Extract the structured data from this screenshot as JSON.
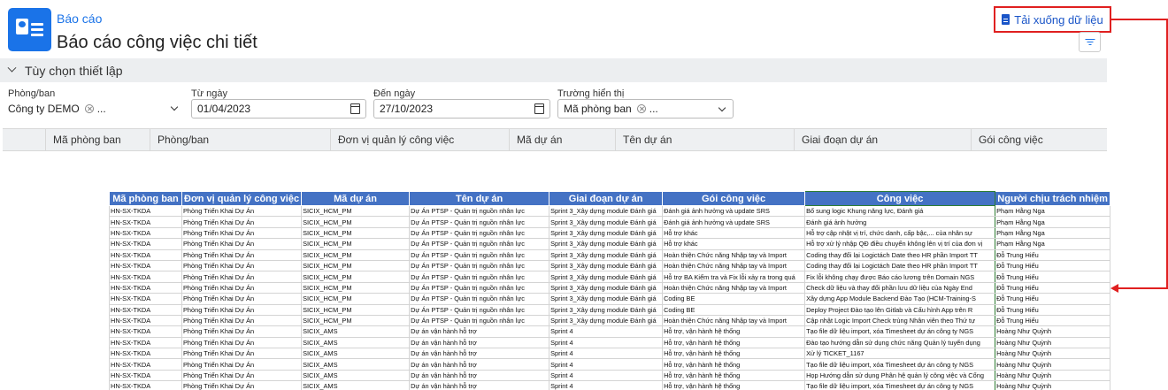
{
  "header": {
    "breadcrumb": "Báo cáo",
    "title": "Báo cáo công việc chi tiết",
    "download_label": "Tải xuống dữ liệu"
  },
  "options": {
    "label": "Tùy chọn thiết lập"
  },
  "filters": {
    "department": {
      "label": "Phòng/ban",
      "value": "Công ty DEMO",
      "more": "..."
    },
    "from_date": {
      "label": "Từ ngày",
      "value": "01/04/2023"
    },
    "to_date": {
      "label": "Đến ngày",
      "value": "27/10/2023"
    },
    "display_field": {
      "label": "Trường hiển thị",
      "value": "Mã phòng ban",
      "more": "..."
    }
  },
  "grid_columns": [
    "Mã phòng ban",
    "Phòng/ban",
    "Đơn vị quản lý công việc",
    "Mã dự án",
    "Tên dự án",
    "Giai đoạn dự án",
    "Gói công việc"
  ],
  "sheet": {
    "headers": [
      "Mã phòng ban",
      "Đơn vị quản lý công việc",
      "Mã dự án",
      "Tên dự án",
      "Giai đoạn dự án",
      "Gói công việc",
      "Công việc",
      "Người chịu trách nhiệm"
    ],
    "rows": [
      [
        "HN-SX-TKDA",
        "Phòng Triển Khai Dự Án",
        "SICIX_HCM_PM",
        "Dự Án PTSP - Quản trị nguồn nhân lực",
        "Sprint 3_Xây dựng module Đánh giá",
        "Đánh giá ảnh hưởng và update SRS",
        "Bổ sung logic Khung năng lực, Đánh giá",
        "Phạm Hằng Nga"
      ],
      [
        "HN-SX-TKDA",
        "Phòng Triển Khai Dự Án",
        "SICIX_HCM_PM",
        "Dự Án PTSP - Quản trị nguồn nhân lực",
        "Sprint 3_Xây dựng module Đánh giá",
        "Đánh giá ảnh hưởng và update SRS",
        "Đánh giá ảnh hưởng",
        "Phạm Hằng Nga"
      ],
      [
        "HN-SX-TKDA",
        "Phòng Triển Khai Dự Án",
        "SICIX_HCM_PM",
        "Dự Án PTSP - Quản trị nguồn nhân lực",
        "Sprint 3_Xây dựng module Đánh giá",
        "Hỗ trợ khác",
        "Hỗ trợ cập nhật vị trí, chức danh, cấp bậc,... của nhân sự",
        "Phạm Hằng Nga"
      ],
      [
        "HN-SX-TKDA",
        "Phòng Triển Khai Dự Án",
        "SICIX_HCM_PM",
        "Dự Án PTSP - Quản trị nguồn nhân lực",
        "Sprint 3_Xây dựng module Đánh giá",
        "Hỗ trợ khác",
        "Hỗ trợ xử lý nhập QĐ điều chuyển không lên vị trí của đơn vị",
        "Phạm Hằng Nga"
      ],
      [
        "HN-SX-TKDA",
        "Phòng Triển Khai Dự Án",
        "SICIX_HCM_PM",
        "Dự Án PTSP - Quản trị nguồn nhân lực",
        "Sprint 3_Xây dựng module Đánh giá",
        "Hoàn thiện Chức năng Nhập tay và Import",
        "Coding thay đổi lại Logictách Date theo HR phần Import TT",
        "Đỗ Trung Hiếu"
      ],
      [
        "HN-SX-TKDA",
        "Phòng Triển Khai Dự Án",
        "SICIX_HCM_PM",
        "Dự Án PTSP - Quản trị nguồn nhân lực",
        "Sprint 3_Xây dựng module Đánh giá",
        "Hoàn thiện Chức năng Nhập tay và Import",
        "Coding thay đổi lại Logictách Date theo HR phần Import TT",
        "Đỗ Trung Hiếu"
      ],
      [
        "HN-SX-TKDA",
        "Phòng Triển Khai Dự Án",
        "SICIX_HCM_PM",
        "Dự Án PTSP - Quản trị nguồn nhân lực",
        "Sprint 3_Xây dựng module Đánh giá",
        "Hỗ trợ BA Kiểm tra và Fix lỗi xảy ra trong quá",
        "Fix lỗi không chạy được Báo cáo lương trên Domain NGS",
        "Đỗ Trung Hiếu"
      ],
      [
        "HN-SX-TKDA",
        "Phòng Triển Khai Dự Án",
        "SICIX_HCM_PM",
        "Dự Án PTSP - Quản trị nguồn nhân lực",
        "Sprint 3_Xây dựng module Đánh giá",
        "Hoàn thiện Chức năng Nhập tay và Import",
        "Check dữ liệu và thay đổi phần lưu dữ liệu của Ngày End",
        "Đỗ Trung Hiếu"
      ],
      [
        "HN-SX-TKDA",
        "Phòng Triển Khai Dự Án",
        "SICIX_HCM_PM",
        "Dự Án PTSP - Quản trị nguồn nhân lực",
        "Sprint 3_Xây dựng module Đánh giá",
        "Coding BE",
        "Xây dựng App Module Backend Đào Tạo (HCM-Training-S",
        "Đỗ Trung Hiếu"
      ],
      [
        "HN-SX-TKDA",
        "Phòng Triển Khai Dự Án",
        "SICIX_HCM_PM",
        "Dự Án PTSP - Quản trị nguồn nhân lực",
        "Sprint 3_Xây dựng module Đánh giá",
        "Coding BE",
        "Deploy Project Đào tạo lên Gitlab và Cấu hình App trên R",
        "Đỗ Trung Hiếu"
      ],
      [
        "HN-SX-TKDA",
        "Phòng Triển Khai Dự Án",
        "SICIX_HCM_PM",
        "Dự Án PTSP - Quản trị nguồn nhân lực",
        "Sprint 3_Xây dựng module Đánh giá",
        "Hoàn thiện Chức năng Nhập tay và Import",
        "Cập nhật Logic Import Check trùng Nhân viên theo Thứ tự",
        "Đỗ Trung Hiếu"
      ],
      [
        "HN-SX-TKDA",
        "Phòng Triển Khai Dự Án",
        "SICIX_AMS",
        "Dự án vận hành hỗ trợ",
        "Sprint 4",
        "Hỗ trợ, vận hành hệ thống",
        "Tạo file dữ liệu import, xóa Timesheet dự án công ty NGS",
        "Hoàng Như Quỳnh"
      ],
      [
        "HN-SX-TKDA",
        "Phòng Triển Khai Dự Án",
        "SICIX_AMS",
        "Dự án vận hành hỗ trợ",
        "Sprint 4",
        "Hỗ trợ, vận hành hệ thống",
        "Đào tạo hướng dẫn sử dụng chức năng Quản lý tuyển dụng",
        "Hoàng Như Quỳnh"
      ],
      [
        "HN-SX-TKDA",
        "Phòng Triển Khai Dự Án",
        "SICIX_AMS",
        "Dự án vận hành hỗ trợ",
        "Sprint 4",
        "Hỗ trợ, vận hành hệ thống",
        "Xử lý TICKET_1167",
        "Hoàng Như Quỳnh"
      ],
      [
        "HN-SX-TKDA",
        "Phòng Triển Khai Dự Án",
        "SICIX_AMS",
        "Dự án vận hành hỗ trợ",
        "Sprint 4",
        "Hỗ trợ, vận hành hệ thống",
        "Tạo file dữ liệu import, xóa Timesheet dự án công ty NGS",
        "Hoàng Như Quỳnh"
      ],
      [
        "HN-SX-TKDA",
        "Phòng Triển Khai Dự Án",
        "SICIX_AMS",
        "Dự án vận hành hỗ trợ",
        "Sprint 4",
        "Hỗ trợ, vận hành hệ thống",
        "Họp Hướng dẫn sử dụng Phân hệ quản lý công việc và Cổng",
        "Hoàng Như Quỳnh"
      ],
      [
        "HN-SX-TKDA",
        "Phòng Triển Khai Dự Án",
        "SICIX_AMS",
        "Dự án vận hành hỗ trợ",
        "Sprint 4",
        "Hỗ trợ, vận hành hệ thống",
        "Tạo file dữ liệu import, xóa Timesheet dự án công ty NGS",
        "Hoàng Như Quỳnh"
      ]
    ]
  },
  "colors": {
    "accent": "#1a73e8",
    "sheet_header": "#4472c4",
    "highlight": "#e02020"
  }
}
